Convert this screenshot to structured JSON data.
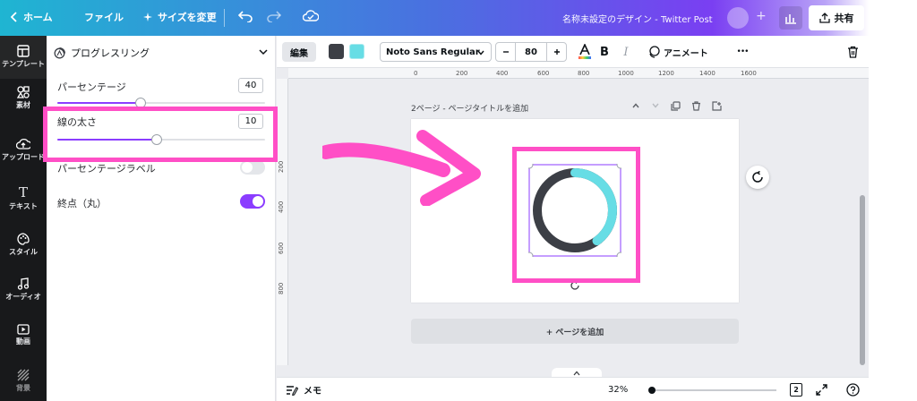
{
  "topbar": {
    "back_icon": "chevron-left-icon",
    "home_label": "ホーム",
    "file_label": "ファイル",
    "resize_label": "サイズを変更",
    "doc_title": "名称未設定のデザイン - Twitter Post",
    "share_label": "共有"
  },
  "rail": {
    "items": [
      {
        "label": "テンプレート",
        "icon": "template-icon"
      },
      {
        "label": "素材",
        "icon": "elements-icon"
      },
      {
        "label": "アップロード",
        "icon": "upload-icon"
      },
      {
        "label": "テキスト",
        "icon": "text-icon"
      },
      {
        "label": "スタイル",
        "icon": "style-icon"
      },
      {
        "label": "オーディオ",
        "icon": "audio-icon"
      },
      {
        "label": "動画",
        "icon": "video-icon"
      },
      {
        "label": "背景",
        "icon": "background-icon"
      }
    ]
  },
  "panel": {
    "title": "プログレスリング",
    "percentage": {
      "label": "パーセンテージ",
      "value": "40",
      "fraction": 0.4
    },
    "stroke": {
      "label": "線の太さ",
      "value": "10",
      "fraction": 0.48
    },
    "percent_label": {
      "label": "パーセンテージラベル",
      "on": false
    },
    "round_ends": {
      "label": "終点（丸）",
      "on": true
    }
  },
  "toolbar": {
    "edit_label": "編集",
    "color1": "#3c3f46",
    "color2": "#67dde5",
    "font_family": "Noto Sans Regular",
    "font_size": "80",
    "bold_label": "B",
    "italic_label": "I",
    "animate_label": "アニメート",
    "more_label": "•••"
  },
  "ruler": {
    "top_ticks": [
      "0",
      "200",
      "400",
      "600",
      "800",
      "1000",
      "1200",
      "1400",
      "1600"
    ],
    "left_ticks": [
      "200",
      "400",
      "600",
      "800"
    ]
  },
  "canvas": {
    "page_label": "2ページ - ページタイトルを追加",
    "add_page_label": "+ ページを追加",
    "ring": {
      "progress": 0.4,
      "progress_color": "#67dde5",
      "track_color": "#3c3f46"
    }
  },
  "bottombar": {
    "notes_label": "メモ",
    "zoom": "32%",
    "page_count": "2"
  },
  "colors": {
    "accent": "#8b3dff",
    "highlight": "#ff4fc6"
  }
}
